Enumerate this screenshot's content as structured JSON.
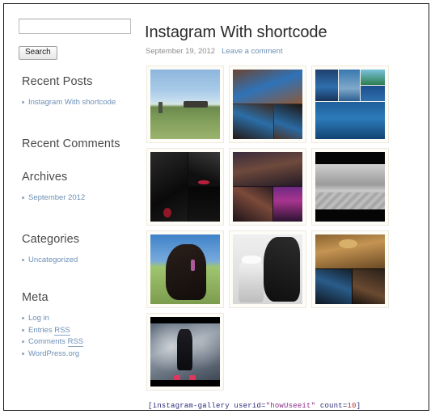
{
  "sidebar": {
    "search": {
      "value": "",
      "placeholder": "",
      "button_label": "Search"
    },
    "widgets": [
      {
        "title": "Recent Posts",
        "items": [
          {
            "label": "Instagram With shortcode"
          }
        ]
      },
      {
        "title": "Recent Comments",
        "items": []
      },
      {
        "title": "Archives",
        "items": [
          {
            "label": "September 2012"
          }
        ]
      },
      {
        "title": "Categories",
        "items": [
          {
            "label": "Uncategorized"
          }
        ]
      },
      {
        "title": "Meta",
        "items": [
          {
            "label": "Log in"
          },
          {
            "label": "Entries",
            "abbr": "RSS"
          },
          {
            "label": "Comments",
            "abbr": "RSS"
          },
          {
            "label": "WordPress.org"
          }
        ]
      }
    ]
  },
  "post": {
    "title": "Instagram With shortcode",
    "date": "September 19, 2012",
    "comment_link": "Leave a comment"
  },
  "gallery": {
    "rows": [
      [
        {
          "name": "helicopter-field-photo",
          "style": "p-field",
          "alt": "Helicopter on green field under blue sky"
        },
        {
          "name": "party-collage-photo",
          "style": "p-party",
          "alt": "Collage of friends in blue shirts at party"
        },
        {
          "name": "pool-collage-photo",
          "style": "p-pool",
          "alt": "Collage of people swimming in pool"
        }
      ],
      [
        {
          "name": "concert-bw-collage-photo",
          "style": "p-stage",
          "alt": "Black and white concert stage collage"
        },
        {
          "name": "nightclub-collage-photo",
          "style": "p-club",
          "alt": "Collage of friends at nightclub"
        },
        {
          "name": "kids-bw-photo",
          "style": "p-kids",
          "alt": "Black and white photo of three kids on couch"
        }
      ],
      [
        {
          "name": "black-horse-photo",
          "style": "p-horse",
          "alt": "Black horse in a sunny field"
        },
        {
          "name": "girl-with-horse-bw-photo",
          "style": "p-bwhorse",
          "alt": "Black and white photo of girl with hat and horse"
        },
        {
          "name": "bar-night-collage-photo",
          "style": "p-bar",
          "alt": "Collage of bar sign and friends at night"
        }
      ],
      [
        {
          "name": "stage-performer-photo",
          "style": "p-perf",
          "alt": "Performer on stage with pink shoes"
        }
      ]
    ]
  },
  "shortcode": {
    "open": "[instagram-gallery userid=",
    "userid_value": "\"howUseeit\"",
    "count_key": " count=",
    "count_value": "10",
    "close": "]"
  }
}
